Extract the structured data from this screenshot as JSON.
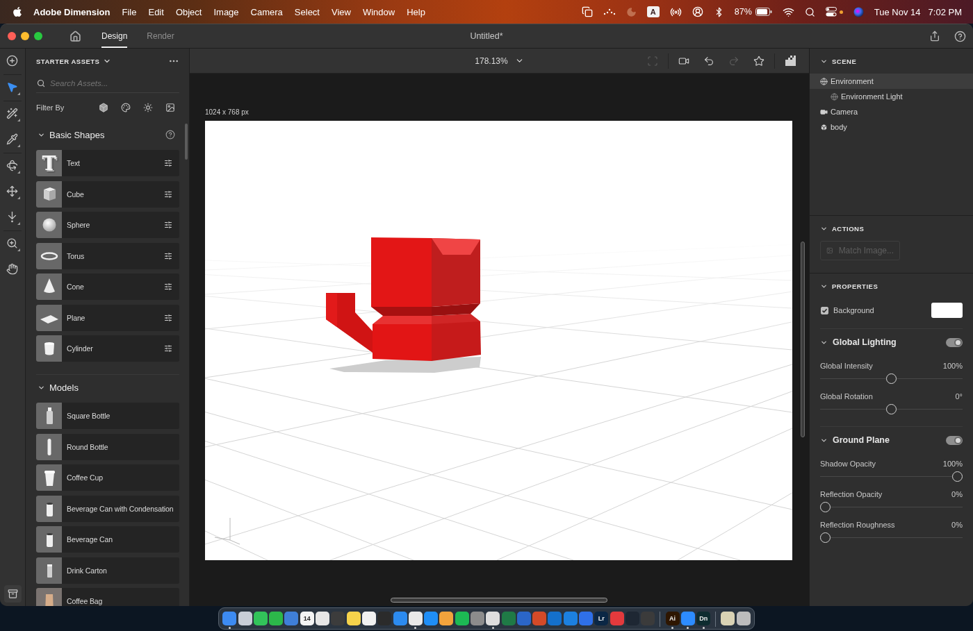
{
  "menu_bar": {
    "app_name": "Adobe Dimension",
    "menus": [
      "File",
      "Edit",
      "Object",
      "Image",
      "Camera",
      "Select",
      "View",
      "Window",
      "Help"
    ],
    "input_source": "A",
    "battery": "87%",
    "privacy_indicator": true,
    "date": "Tue Nov 14",
    "time": "7:02 PM"
  },
  "window": {
    "title": "Untitled*",
    "tabs": [
      {
        "label": "Design",
        "selected": true
      },
      {
        "label": "Render",
        "selected": false
      }
    ]
  },
  "tool_groups": [
    {
      "tools": [
        {
          "kind": "add",
          "selected": false,
          "flyout": false
        }
      ]
    },
    {
      "tools": [
        {
          "kind": "select",
          "selected": true,
          "flyout": true
        }
      ]
    },
    {
      "tools": [
        {
          "kind": "magic-wand",
          "selected": false,
          "flyout": true
        },
        {
          "kind": "eyedropper",
          "selected": false,
          "flyout": true
        }
      ]
    },
    {
      "tools": [
        {
          "kind": "orbit",
          "selected": false,
          "flyout": true
        },
        {
          "kind": "pan",
          "selected": false,
          "flyout": true
        },
        {
          "kind": "dolly",
          "selected": false,
          "flyout": true
        }
      ]
    },
    {
      "tools": [
        {
          "kind": "zoom",
          "selected": false,
          "flyout": true
        },
        {
          "kind": "hand",
          "selected": false,
          "flyout": false
        }
      ]
    }
  ],
  "assets_panel": {
    "title": "STARTER ASSETS",
    "search": {
      "placeholder": "Search Assets..."
    },
    "filter_label": "Filter By",
    "sections": [
      {
        "title": "Basic Shapes",
        "expanded": true,
        "help": true,
        "items": [
          {
            "name": "Text",
            "kind": "text",
            "glyph": "T",
            "options": true
          },
          {
            "name": "Cube",
            "kind": "cube",
            "options": true
          },
          {
            "name": "Sphere",
            "kind": "sphere",
            "options": true
          },
          {
            "name": "Torus",
            "kind": "torus",
            "options": true
          },
          {
            "name": "Cone",
            "kind": "cone",
            "options": true
          },
          {
            "name": "Plane",
            "kind": "plane",
            "options": true
          },
          {
            "name": "Cylinder",
            "kind": "cylinder",
            "options": true
          }
        ]
      },
      {
        "title": "Models",
        "expanded": true,
        "help": false,
        "items": [
          {
            "name": "Square Bottle",
            "kind": "square-bottle",
            "options": false
          },
          {
            "name": "Round Bottle",
            "kind": "round-bottle",
            "options": false
          },
          {
            "name": "Coffee Cup",
            "kind": "coffee-cup",
            "options": false
          },
          {
            "name": "Beverage Can with Condensation",
            "kind": "can",
            "options": false
          },
          {
            "name": "Beverage Can",
            "kind": "can",
            "options": false
          },
          {
            "name": "Drink Carton",
            "kind": "carton",
            "options": false
          },
          {
            "name": "Coffee Bag",
            "kind": "coffee-bag",
            "options": false
          }
        ]
      }
    ]
  },
  "canvas": {
    "zoom": "178.13%",
    "size_label": "1024 x 768 px",
    "view_tool_groups": [
      {
        "tools": [
          {
            "kind": "frame",
            "disabled": true
          }
        ]
      },
      {
        "tools": [
          {
            "kind": "camera-fit",
            "disabled": false
          },
          {
            "kind": "camera-undo",
            "disabled": false
          },
          {
            "kind": "camera-redo",
            "disabled": true
          },
          {
            "kind": "camera-bookmark",
            "disabled": false
          }
        ]
      },
      {
        "tools": [
          {
            "kind": "render-preview",
            "disabled": false
          }
        ]
      }
    ]
  },
  "scene": {
    "title": "SCENE",
    "expanded": true,
    "items": [
      {
        "label": "Environment",
        "kind": "environment",
        "selected": true,
        "children": [
          {
            "label": "Environment Light",
            "kind": "light",
            "selected": false
          }
        ]
      },
      {
        "label": "Camera",
        "kind": "camera",
        "selected": false
      },
      {
        "label": "body",
        "kind": "mesh",
        "selected": false
      }
    ]
  },
  "actions": {
    "title": "ACTIONS",
    "expanded": true,
    "button": {
      "label": "Match Image...",
      "disabled": true
    }
  },
  "properties": {
    "title": "PROPERTIES",
    "expanded": true,
    "background": {
      "label": "Background",
      "checked": true,
      "color": "#ffffff"
    },
    "groups": [
      {
        "title": "Global Lighting",
        "expanded": true,
        "on": true,
        "sliders": [
          {
            "label": "Global Intensity",
            "reading": "100%",
            "level": 0.5
          },
          {
            "label": "Global Rotation",
            "reading": "0°",
            "level": 0.5
          }
        ]
      },
      {
        "title": "Ground Plane",
        "expanded": true,
        "on": true,
        "sliders": [
          {
            "label": "Shadow Opacity",
            "reading": "100%",
            "level": 1
          },
          {
            "label": "Reflection Opacity",
            "reading": "0%",
            "level": 0
          },
          {
            "label": "Reflection Roughness",
            "reading": "0%",
            "level": 0
          }
        ]
      }
    ]
  },
  "dock": {
    "sections": [
      {
        "items": [
          {
            "color": "#3d8bf2",
            "running": true
          },
          {
            "color": "#c9ced8",
            "running": false
          },
          {
            "color": "#32c35a",
            "running": false
          },
          {
            "color": "#2cb84a",
            "running": false
          },
          {
            "color": "#3f7fd8",
            "running": false
          },
          {
            "color": "#f4f4f4",
            "label": "14",
            "running": false
          },
          {
            "color": "#e6e6e6",
            "running": false
          },
          {
            "color": "#3c3c3c",
            "running": false
          },
          {
            "color": "#f5d24b",
            "running": false
          },
          {
            "color": "#f1f1f1",
            "running": false
          },
          {
            "color": "#2b2b2b",
            "running": false
          },
          {
            "color": "#2c8bf0",
            "running": false
          },
          {
            "color": "#e9e9e9",
            "running": true
          },
          {
            "color": "#1f8ef6",
            "running": false
          },
          {
            "color": "#f2a33c",
            "running": false
          },
          {
            "color": "#1db954",
            "running": false
          },
          {
            "color": "#8c8c8c",
            "running": false
          },
          {
            "color": "#dedede",
            "running": true
          },
          {
            "color": "#1f7a46",
            "running": false
          },
          {
            "color": "#2b66c8",
            "running": false
          },
          {
            "color": "#d34a28",
            "running": false
          },
          {
            "color": "#1470cc",
            "running": false
          },
          {
            "color": "#1c80e0",
            "running": false
          },
          {
            "color": "#2f70e9",
            "running": false
          },
          {
            "color": "#0b2745",
            "label": "Lr",
            "running": false
          },
          {
            "color": "#e33a3d",
            "running": false
          },
          {
            "color": "#1e2733",
            "running": false
          },
          {
            "color": "#3b3b3b",
            "running": false
          }
        ]
      },
      {
        "items": [
          {
            "color": "#2e1600",
            "label": "Ai",
            "running": true
          },
          {
            "color": "#2d8cff",
            "running": true
          },
          {
            "color": "#0e2c30",
            "label": "Dn",
            "running": true
          }
        ]
      },
      {
        "items": [
          {
            "color": "#d9d2b4",
            "running": false
          },
          {
            "color": "#bcbcbc",
            "running": false
          }
        ]
      }
    ]
  }
}
